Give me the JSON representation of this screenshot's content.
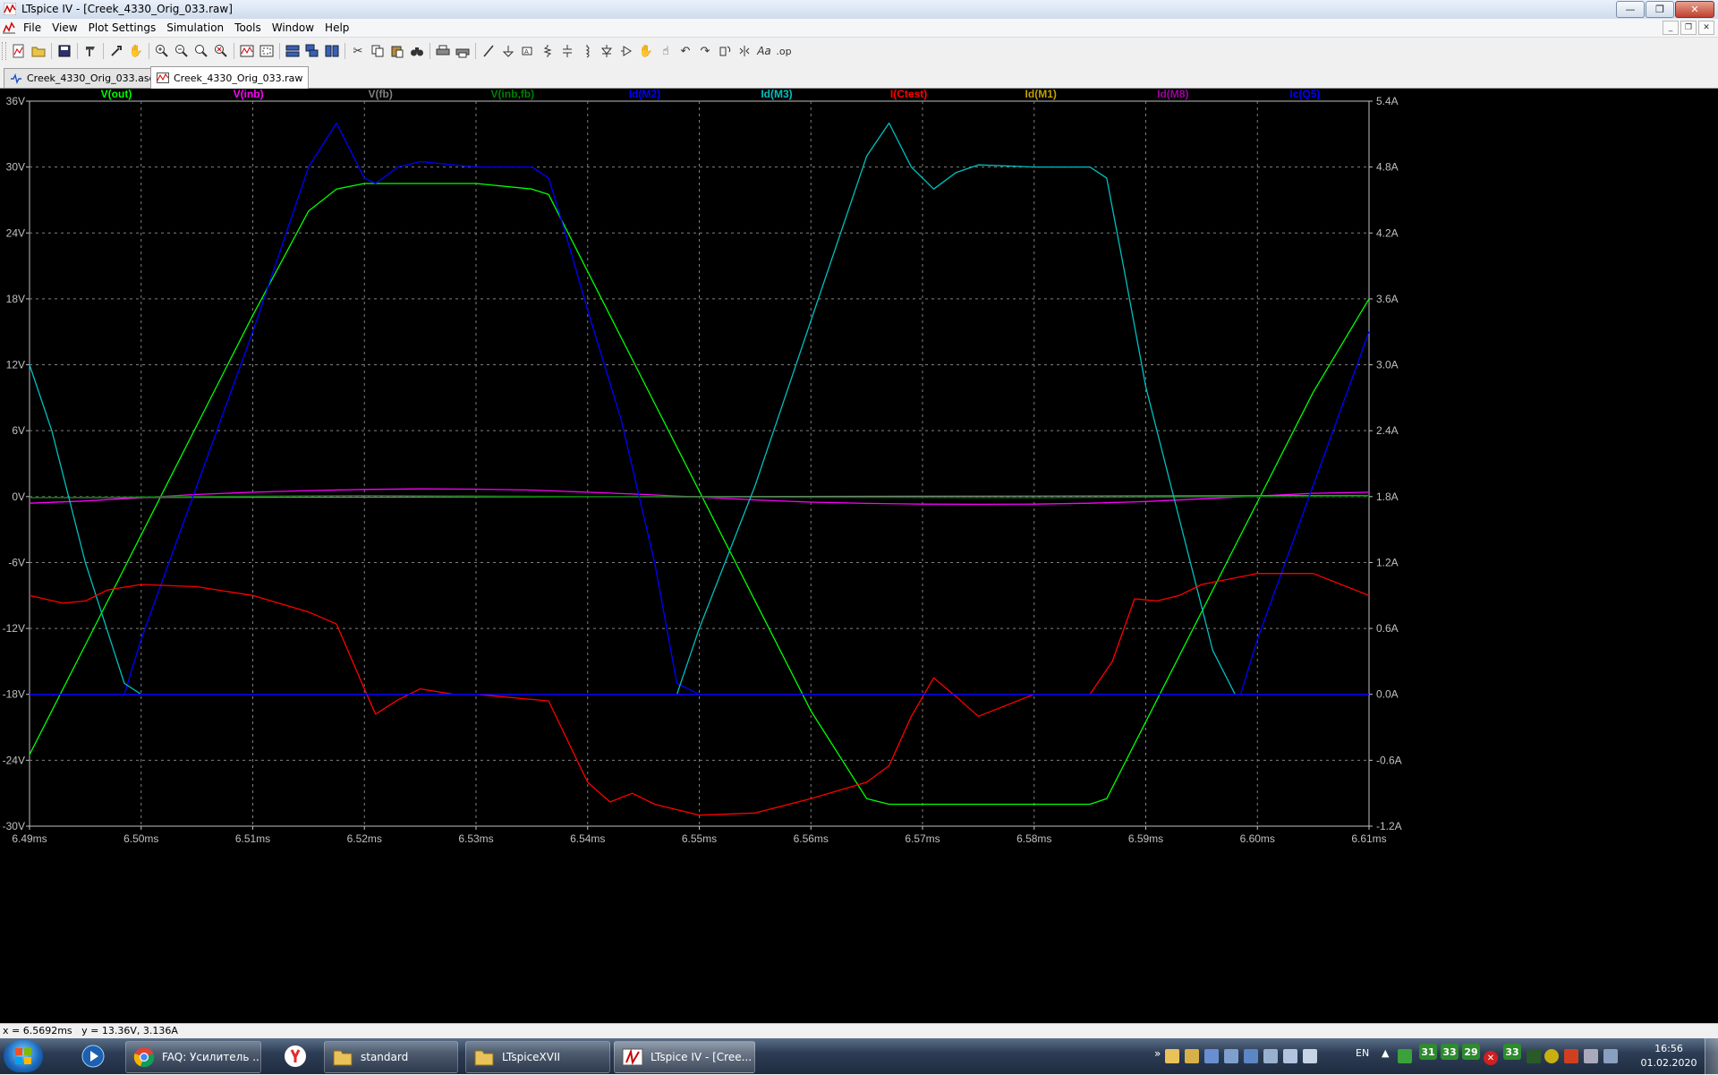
{
  "window": {
    "title": "LTspice IV - [Creek_4330_Orig_033.raw]",
    "buttons": [
      "minimize",
      "restore",
      "close"
    ]
  },
  "menubar": {
    "items": [
      {
        "label": "File"
      },
      {
        "label": "View"
      },
      {
        "label": "Plot Settings"
      },
      {
        "label": "Simulation"
      },
      {
        "label": "Tools"
      },
      {
        "label": "Window"
      },
      {
        "label": "Help"
      }
    ]
  },
  "toolbar": {
    "icons": [
      "new-schematic-icon",
      "open-icon",
      "save-icon",
      "control-panel-icon",
      "run-icon",
      "pan-icon",
      "zoom-in-icon",
      "zoom-out-icon",
      "zoom-full-icon",
      "zoom-cancel-icon",
      "autoscale-icon",
      "zoom-extents-icon",
      "tile-horizontal-icon",
      "cascade-icon",
      "tile-vertical-icon",
      "cut-icon",
      "copy-icon",
      "paste-icon",
      "find-icon",
      "print-icon",
      "print-preview-icon",
      "wire-icon",
      "ground-icon",
      "label-icon",
      "resistor-icon",
      "capacitor-icon",
      "inductor-icon",
      "diode-icon",
      "component-icon",
      "move-icon",
      "drag-icon",
      "undo-icon",
      "redo-icon",
      "rotate-icon",
      "mirror-icon",
      "text-icon",
      "spice-directive-icon"
    ]
  },
  "tabs": [
    {
      "label": "Creek_4330_Orig_033.asc",
      "active": false
    },
    {
      "label": "Creek_4330_Orig_033.raw",
      "active": true
    }
  ],
  "chart_data": {
    "type": "line",
    "title": "",
    "xlabel": "",
    "x_ticks": [
      "6.49ms",
      "6.50ms",
      "6.51ms",
      "6.52ms",
      "6.53ms",
      "6.54ms",
      "6.55ms",
      "6.56ms",
      "6.57ms",
      "6.58ms",
      "6.59ms",
      "6.60ms",
      "6.61ms"
    ],
    "xlim": [
      6.49,
      6.61
    ],
    "y_left_ticks": [
      "36V",
      "30V",
      "24V",
      "18V",
      "12V",
      "6V",
      "0V",
      "-6V",
      "-12V",
      "-18V",
      "-24V",
      "-30V"
    ],
    "ylim_left": [
      -30,
      36
    ],
    "y_right_ticks": [
      "5.4A",
      "4.8A",
      "4.2A",
      "3.6A",
      "3.0A",
      "2.4A",
      "1.8A",
      "1.2A",
      "0.6A",
      "0.0A",
      "-0.6A",
      "-1.2A"
    ],
    "ylim_right": [
      -1.2,
      5.4
    ],
    "grid": true,
    "legend_placement": "top",
    "series": [
      {
        "name": "V(out)",
        "color": "#00ff00",
        "axis": "left",
        "x": [
          6.49,
          6.495,
          6.5,
          6.505,
          6.51,
          6.515,
          6.5175,
          6.52,
          6.525,
          6.53,
          6.535,
          6.5365,
          6.54,
          6.545,
          6.55,
          6.555,
          6.56,
          6.565,
          6.567,
          6.57,
          6.575,
          6.58,
          6.585,
          6.5865,
          6.59,
          6.595,
          6.6,
          6.605,
          6.61
        ],
        "y": [
          -23.5,
          -13.5,
          -3.5,
          6.5,
          16.5,
          26.0,
          28.0,
          28.5,
          28.5,
          28.5,
          28.0,
          27.5,
          20.5,
          10.5,
          0.5,
          -9.5,
          -19.5,
          -27.5,
          -28.0,
          -28.0,
          -28.0,
          -28.0,
          -28.0,
          -27.5,
          -20.5,
          -10.5,
          -0.5,
          9.5,
          18.0
        ]
      },
      {
        "name": "V(inb)",
        "color": "#ff00ff",
        "axis": "left",
        "x": [
          6.49,
          6.495,
          6.5,
          6.505,
          6.51,
          6.515,
          6.52,
          6.525,
          6.53,
          6.535,
          6.54,
          6.545,
          6.55,
          6.555,
          6.56,
          6.565,
          6.57,
          6.575,
          6.58,
          6.585,
          6.59,
          6.595,
          6.6,
          6.605,
          6.61
        ],
        "y": [
          -0.6,
          -0.4,
          -0.1,
          0.2,
          0.4,
          0.55,
          0.65,
          0.7,
          0.68,
          0.6,
          0.4,
          0.2,
          -0.05,
          -0.3,
          -0.5,
          -0.62,
          -0.68,
          -0.7,
          -0.68,
          -0.6,
          -0.45,
          -0.2,
          0.05,
          0.3,
          0.4
        ]
      },
      {
        "name": "V(fb)",
        "color": "#808080",
        "axis": "left",
        "x": [
          6.49,
          6.61
        ],
        "y": [
          -0.1,
          0.1
        ]
      },
      {
        "name": "V(inb,fb)",
        "color": "#008000",
        "axis": "left",
        "x": [
          6.49,
          6.52,
          6.55,
          6.58,
          6.61
        ],
        "y": [
          -0.1,
          0.1,
          -0.05,
          -0.1,
          0.05
        ]
      },
      {
        "name": "Id(M2)",
        "color": "#0000ff",
        "axis": "right",
        "x": [
          6.49,
          6.495,
          6.4985,
          6.5,
          6.505,
          6.51,
          6.515,
          6.5175,
          6.52,
          6.521,
          6.523,
          6.525,
          6.53,
          6.535,
          6.5365,
          6.538,
          6.54,
          6.543,
          6.546,
          6.548,
          6.55,
          6.56,
          6.57,
          6.58,
          6.59,
          6.5985,
          6.6,
          6.605,
          6.61
        ],
        "y": [
          0.0,
          0.0,
          0.0,
          0.5,
          1.9,
          3.3,
          4.8,
          5.2,
          4.7,
          4.65,
          4.8,
          4.85,
          4.8,
          4.8,
          4.7,
          4.2,
          3.5,
          2.5,
          1.2,
          0.1,
          0.0,
          0.0,
          0.0,
          0.0,
          0.0,
          0.0,
          0.5,
          1.9,
          3.3
        ]
      },
      {
        "name": "Id(M3)",
        "color": "#00c0c0",
        "axis": "right",
        "x": [
          6.49,
          6.492,
          6.495,
          6.4985,
          6.5,
          6.51,
          6.52,
          6.53,
          6.54,
          6.548,
          6.55,
          6.555,
          6.56,
          6.565,
          6.567,
          6.569,
          6.571,
          6.573,
          6.575,
          6.58,
          6.585,
          6.5865,
          6.588,
          6.59,
          6.593,
          6.596,
          6.598,
          6.6,
          6.61
        ],
        "y": [
          3.0,
          2.4,
          1.2,
          0.1,
          0.0,
          0.0,
          0.0,
          0.0,
          0.0,
          0.0,
          0.6,
          1.9,
          3.4,
          4.9,
          5.2,
          4.8,
          4.6,
          4.75,
          4.82,
          4.8,
          4.8,
          4.7,
          3.9,
          2.8,
          1.6,
          0.4,
          0.0,
          0.0,
          0.0
        ]
      },
      {
        "name": "I(Ctest)",
        "color": "#ff0000",
        "axis": "right",
        "x": [
          6.49,
          6.493,
          6.495,
          6.497,
          6.5,
          6.505,
          6.51,
          6.515,
          6.5175,
          6.52,
          6.521,
          6.523,
          6.525,
          6.528,
          6.53,
          6.5365,
          6.54,
          6.542,
          6.544,
          6.546,
          6.55,
          6.555,
          6.56,
          6.565,
          6.567,
          6.569,
          6.571,
          6.573,
          6.575,
          6.58,
          6.585,
          6.587,
          6.589,
          6.591,
          6.593,
          6.595,
          6.6,
          6.605,
          6.61
        ],
        "y": [
          0.9,
          0.83,
          0.85,
          0.95,
          1.0,
          0.98,
          0.9,
          0.75,
          0.64,
          0.05,
          -0.18,
          -0.05,
          0.05,
          0.0,
          0.0,
          -0.06,
          -0.8,
          -0.98,
          -0.9,
          -1.0,
          -1.1,
          -1.08,
          -0.95,
          -0.8,
          -0.65,
          -0.2,
          0.15,
          -0.02,
          -0.2,
          0.0,
          0.0,
          0.3,
          0.87,
          0.85,
          0.9,
          1.0,
          1.1,
          1.1,
          0.9
        ]
      },
      {
        "name": "Id(M1)",
        "color": "#c0a000",
        "axis": "right",
        "x": [
          6.49,
          6.61
        ],
        "y": [
          0.0,
          0.0
        ]
      },
      {
        "name": "Id(M8)",
        "color": "#a000a0",
        "axis": "right",
        "x": [
          6.49,
          6.61
        ],
        "y": [
          0.0,
          0.0
        ]
      },
      {
        "name": "Ic(Q5)",
        "color": "#0000ff",
        "axis": "right",
        "x": [
          6.49,
          6.61
        ],
        "y": [
          0.0,
          0.0
        ]
      }
    ]
  },
  "status": {
    "x_readout": "x = 6.5692ms",
    "y_readout": "y = 13.36V, 3.136A"
  },
  "taskbar": {
    "tasks": [
      {
        "label": "FAQ: Усилитель ...",
        "icon": "chrome-icon"
      },
      {
        "label": "standard",
        "icon": "folder-icon"
      },
      {
        "label": "LTspiceXVII",
        "icon": "folder-icon"
      },
      {
        "label": "LTspice IV - [Cree...",
        "icon": "ltspice-icon",
        "active": true
      }
    ],
    "tray_numbers": [
      "31",
      "33",
      "29",
      "33"
    ],
    "language": "EN",
    "time": "16:56",
    "date": "01.02.2020"
  }
}
